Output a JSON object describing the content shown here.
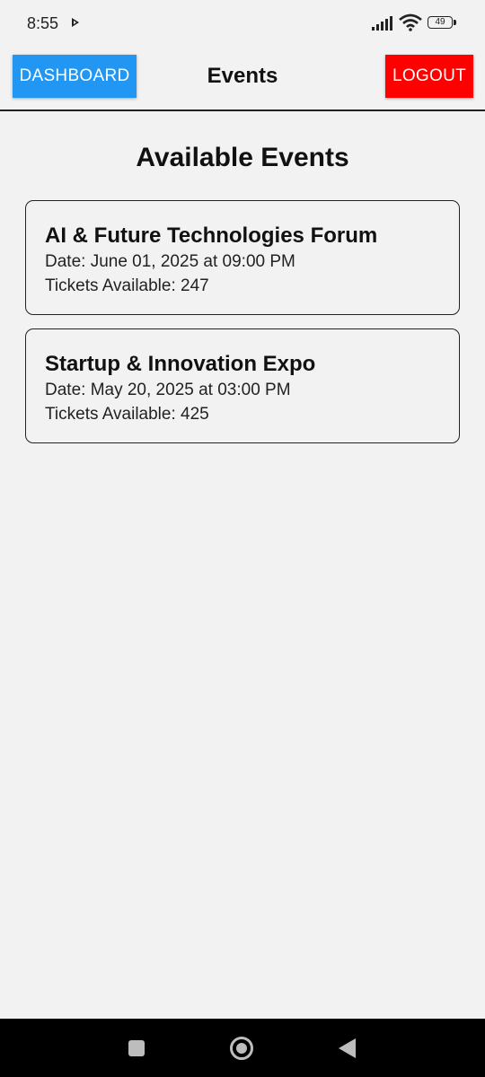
{
  "status_bar": {
    "time": "8:55",
    "battery_level": "49",
    "icons": [
      "play-icon",
      "signal-icon",
      "wifi-icon",
      "battery-icon"
    ]
  },
  "header": {
    "dashboard_label": "DASHBOARD",
    "title": "Events",
    "logout_label": "LOGOUT"
  },
  "main": {
    "title": "Available Events",
    "events": [
      {
        "name": "AI & Future Technologies Forum",
        "date": "Date: June 01, 2025 at 09:00 PM",
        "tickets": "Tickets Available: 247"
      },
      {
        "name": "Startup & Innovation Expo",
        "date": "Date: May 20, 2025 at 03:00 PM",
        "tickets": "Tickets Available: 425"
      }
    ]
  },
  "nav_bar": {
    "icons": [
      "recents-square-icon",
      "home-circle-icon",
      "back-triangle-icon"
    ]
  },
  "colors": {
    "dashboard_button": "#2196f3",
    "logout_button": "#ff0000",
    "background": "#f2f2f2",
    "nav_bar": "#000000"
  }
}
